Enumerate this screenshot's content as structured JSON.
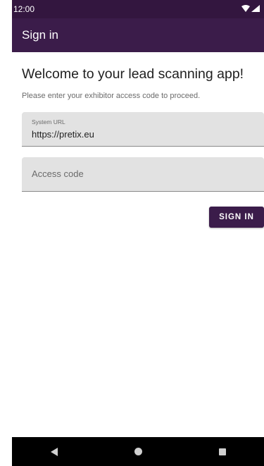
{
  "status_bar": {
    "time": "12:00"
  },
  "app_bar": {
    "title": "Sign in"
  },
  "main": {
    "welcome": "Welcome to your lead scanning app!",
    "subtitle": "Please enter your exhibitor access code to proceed.",
    "system_url_field": {
      "label": "System URL",
      "value": "https://pretix.eu"
    },
    "access_code_field": {
      "placeholder": "Access code"
    },
    "sign_in_label": "SIGN IN"
  },
  "colors": {
    "primary": "#3b1c4a",
    "status_bar": "#33163f",
    "field_background": "#e2e2e2"
  },
  "icons": [
    "wifi-icon",
    "signal-icon",
    "back-icon",
    "home-icon",
    "recents-icon"
  ]
}
